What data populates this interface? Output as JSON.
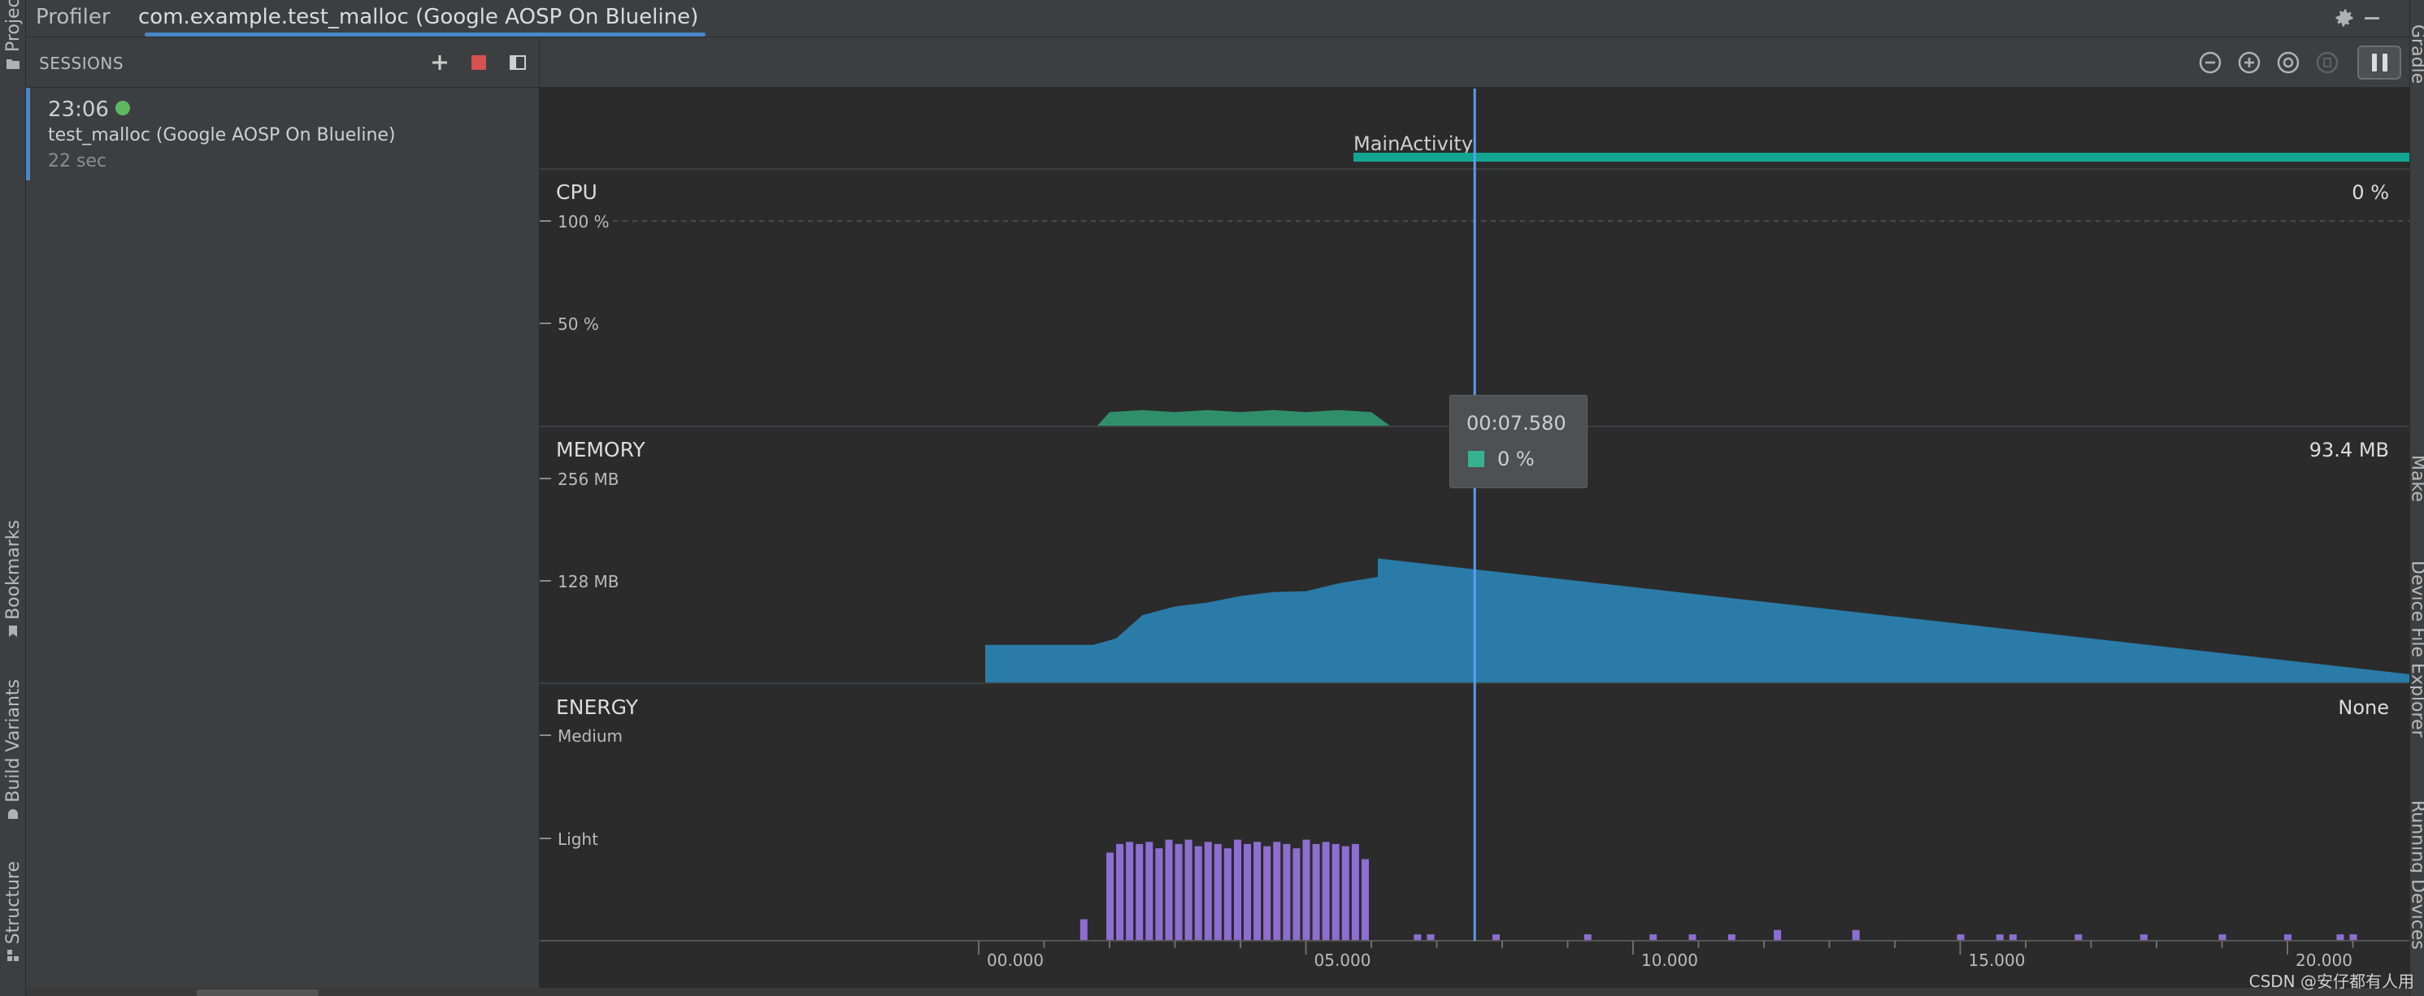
{
  "top_tabs": {
    "profiler": "Profiler",
    "app": "com.example.test_malloc (Google AOSP On Blueline)"
  },
  "left_tool_tabs": [
    "Project",
    "Bookmarks",
    "Build Variants",
    "Structure"
  ],
  "right_tool_tabs": [
    "Gradle",
    "Make",
    "Device File Explorer",
    "Running Devices"
  ],
  "sessions": {
    "title": "SESSIONS",
    "item": {
      "time": "23:06",
      "name": "test_malloc (Google AOSP On Blueline)",
      "duration": "22 sec",
      "status_color": "#5fb85f"
    }
  },
  "toolbar_icons": [
    "zoom-out-icon",
    "zoom-in-icon",
    "reset-zoom-icon",
    "attach-live-icon",
    "pause-icon"
  ],
  "activity": {
    "label": "MainActivity",
    "color": "#12a591"
  },
  "cpu": {
    "title": "CPU",
    "current": "0 %",
    "ticks": [
      "100 %",
      "50 %"
    ],
    "color": "#2f8f6a"
  },
  "memory": {
    "title": "MEMORY",
    "current": "93.4 MB",
    "ticks": [
      "256 MB",
      "128 MB"
    ],
    "color": "#2a7ba8"
  },
  "energy": {
    "title": "ENERGY",
    "current": "None",
    "ticks": [
      "Medium",
      "Light"
    ],
    "color": "#8e6ed0"
  },
  "time_axis": {
    "labels": [
      "00.000",
      "05.000",
      "10.000",
      "15.000",
      "20.000"
    ]
  },
  "cursor": {
    "time_seconds": 7.58,
    "color": "#589df6"
  },
  "tooltip": {
    "time": "00:07.580",
    "value": "0 %",
    "swatch_color": "#35b28f"
  },
  "watermark": "CSDN @安仔都有人用",
  "chart_data": [
    {
      "type": "area",
      "title": "CPU",
      "x_unit": "s",
      "ylim": [
        0,
        100
      ],
      "x": [
        1.8,
        2.0,
        2.5,
        3.0,
        3.5,
        4.0,
        4.5,
        5.0,
        5.5,
        6.0,
        6.3
      ],
      "values": [
        0,
        7,
        8,
        7,
        8,
        7,
        8,
        7,
        8,
        7,
        0
      ]
    },
    {
      "type": "area",
      "title": "MEMORY",
      "y_unit": "MB",
      "ylim": [
        0,
        256
      ],
      "x": [
        0.1,
        0.1,
        1.6,
        1.75,
        2.1,
        2.5,
        3.0,
        3.5,
        4.0,
        4.5,
        5.0,
        5.5,
        6.1,
        6.1,
        23.1,
        23.1
      ],
      "values": [
        0,
        48,
        48,
        48,
        56,
        85,
        96,
        101,
        109,
        114,
        115,
        125,
        133,
        156,
        0,
        0
      ]
    },
    {
      "type": "bar",
      "title": "ENERGY",
      "categories_note": "time seconds",
      "ylim_levels": [
        "Light",
        "Medium"
      ],
      "x": [
        1.6,
        2.0,
        2.15,
        2.3,
        2.45,
        2.6,
        2.75,
        2.9,
        3.05,
        3.2,
        3.35,
        3.5,
        3.65,
        3.8,
        3.95,
        4.1,
        4.25,
        4.4,
        4.55,
        4.7,
        4.85,
        5.0,
        5.15,
        5.3,
        5.45,
        5.6,
        5.75,
        5.9,
        6.7,
        6.9,
        7.9,
        9.3,
        10.3,
        10.9,
        11.5,
        12.2,
        13.4,
        15.0,
        15.6,
        15.8,
        16.8,
        17.8,
        19.0,
        20.0,
        20.8,
        21.0,
        22.0
      ],
      "values": [
        0.2,
        0.82,
        0.9,
        0.92,
        0.9,
        0.92,
        0.86,
        0.94,
        0.9,
        0.94,
        0.88,
        0.92,
        0.9,
        0.86,
        0.94,
        0.9,
        0.92,
        0.88,
        0.92,
        0.9,
        0.86,
        0.94,
        0.9,
        0.92,
        0.9,
        0.88,
        0.9,
        0.76,
        0.06,
        0.06,
        0.06,
        0.06,
        0.06,
        0.06,
        0.06,
        0.1,
        0.1,
        0.06,
        0.06,
        0.06,
        0.06,
        0.06,
        0.06,
        0.06,
        0.06,
        0.06,
        0.1
      ]
    }
  ]
}
